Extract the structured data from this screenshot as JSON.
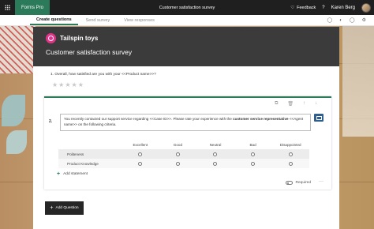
{
  "app": {
    "name": "Forms Pro",
    "doc_title": "Customer satisfaction survey",
    "feedback_label": "Feedback",
    "help_label": "?",
    "user_name": "Karen Berg"
  },
  "tabs": [
    {
      "label": "Create questions",
      "active": true
    },
    {
      "label": "Send survey",
      "active": false
    },
    {
      "label": "View responses",
      "active": false
    }
  ],
  "header": {
    "brand": "Tailspin toys",
    "title": "Customer satisfaction survey"
  },
  "question1": {
    "text": "1.  Overall, how satisfied are you with your <<Product name>>?",
    "stars": [
      "★",
      "★",
      "★",
      "★",
      "★"
    ]
  },
  "question2": {
    "number": "2.",
    "text_part1": "You recently contacted our support service regarding <<Case ID>>. Please rate your experience with the ",
    "text_bold": "customer service representative",
    "text_part2": " <<Agent name>> on the following criteria.",
    "columns": [
      "Excellent",
      "Good",
      "Neutral",
      "Bad",
      "Disappointed"
    ],
    "rows": [
      "Politeness",
      "Product Knowledge"
    ],
    "add_statement": "Add statement",
    "required_label": "Required",
    "more": "···"
  },
  "add_question_label": "Add Question",
  "icons": [
    "waffle-icon",
    "feedback-icon",
    "help-icon",
    "avatar",
    "preview-icon",
    "theme-icon",
    "share-icon",
    "settings-icon",
    "copy-icon",
    "delete-icon",
    "move-up-icon",
    "move-down-icon",
    "image-icon",
    "plus-icon"
  ],
  "colors": {
    "accent": "#2b7a5a",
    "header_bg": "#3b3b3b",
    "brand_logo": "#e0338a",
    "topbar": "#1f1f1f"
  }
}
